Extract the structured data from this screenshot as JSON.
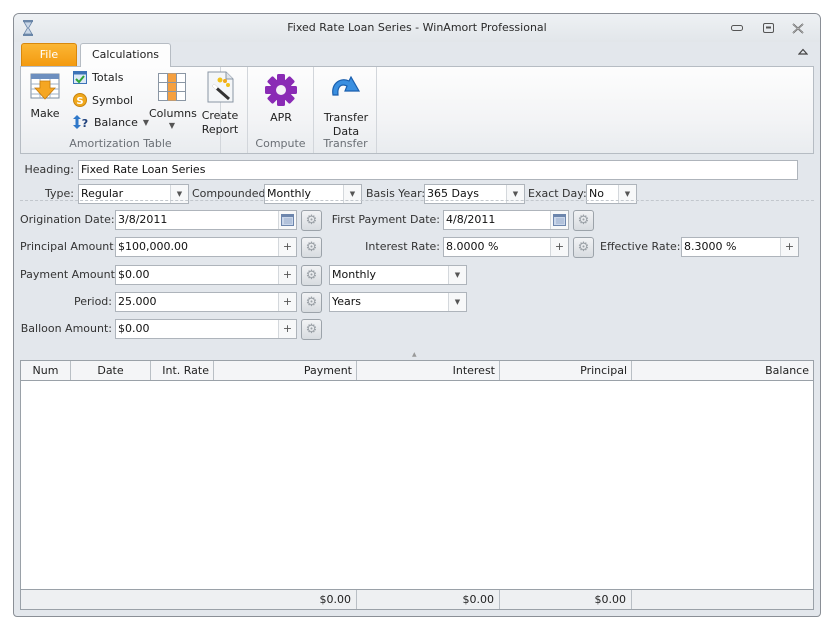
{
  "window": {
    "title": "Fixed Rate Loan Series - WinAmort Professional",
    "app_icon": "hourglass-icon",
    "controls": {
      "minimize": "minimize-icon",
      "restore": "restore-icon",
      "close": "close-icon"
    }
  },
  "tabs": [
    {
      "label": "File",
      "active": false
    },
    {
      "label": "Calculations",
      "active": true
    }
  ],
  "ribbon": {
    "collapse_icon": "chevron-up-icon",
    "groups": [
      {
        "label": "Amortization Table",
        "make": {
          "label": "Make",
          "icon": "table-arrow-icon"
        },
        "totals": {
          "label": "Totals",
          "icon": "checkbox-icon"
        },
        "symbol": {
          "label": "Symbol",
          "icon": "dollar-coin-icon"
        },
        "balance": {
          "label": "Balance",
          "icon": "up-down-question-icon"
        },
        "columns": {
          "label": "Columns",
          "icon": "columns-icon"
        },
        "create_report": {
          "label_line1": "Create",
          "label_line2": "Report",
          "icon": "report-wand-icon"
        }
      },
      {
        "label": "Compute",
        "apr": {
          "label": "APR",
          "icon": "gear-icon"
        }
      },
      {
        "label": "Transfer",
        "transfer_data": {
          "label_line1": "Transfer",
          "label_line2": "Data",
          "icon": "curved-arrow-icon"
        }
      }
    ]
  },
  "form": {
    "heading": {
      "label": "Heading:",
      "value": "Fixed Rate Loan Series"
    },
    "type": {
      "label": "Type:",
      "value": "Regular"
    },
    "compounded": {
      "label": "Compounded:",
      "value": "Monthly"
    },
    "basis_year": {
      "label": "Basis Year:",
      "value": "365 Days"
    },
    "exact_day": {
      "label": "Exact Day:",
      "value": "No"
    },
    "origination_date": {
      "label": "Origination Date:",
      "value": "3/8/2011"
    },
    "first_payment_date": {
      "label": "First Payment Date:",
      "value": "4/8/2011"
    },
    "principal_amount": {
      "label": "Principal Amount:",
      "value": "$100,000.00"
    },
    "interest_rate": {
      "label": "Interest Rate:",
      "value": "8.0000 %"
    },
    "effective_rate": {
      "label": "Effective Rate:",
      "value": "8.3000 %"
    },
    "payment_amount": {
      "label": "Payment Amount:",
      "value": "$0.00"
    },
    "payment_frequency": {
      "value": "Monthly"
    },
    "period": {
      "label": "Period:",
      "value": "25.000"
    },
    "period_unit": {
      "value": "Years"
    },
    "balloon_amount": {
      "label": "Balloon Amount:",
      "value": "$0.00"
    },
    "plus_symbol": "+"
  },
  "table": {
    "columns": [
      "Num",
      "Date",
      "Int. Rate",
      "Payment",
      "Interest",
      "Principal",
      "Balance"
    ],
    "rows": [],
    "totals": {
      "payment": "$0.00",
      "interest": "$0.00",
      "principal": "$0.00",
      "balance": ""
    }
  }
}
